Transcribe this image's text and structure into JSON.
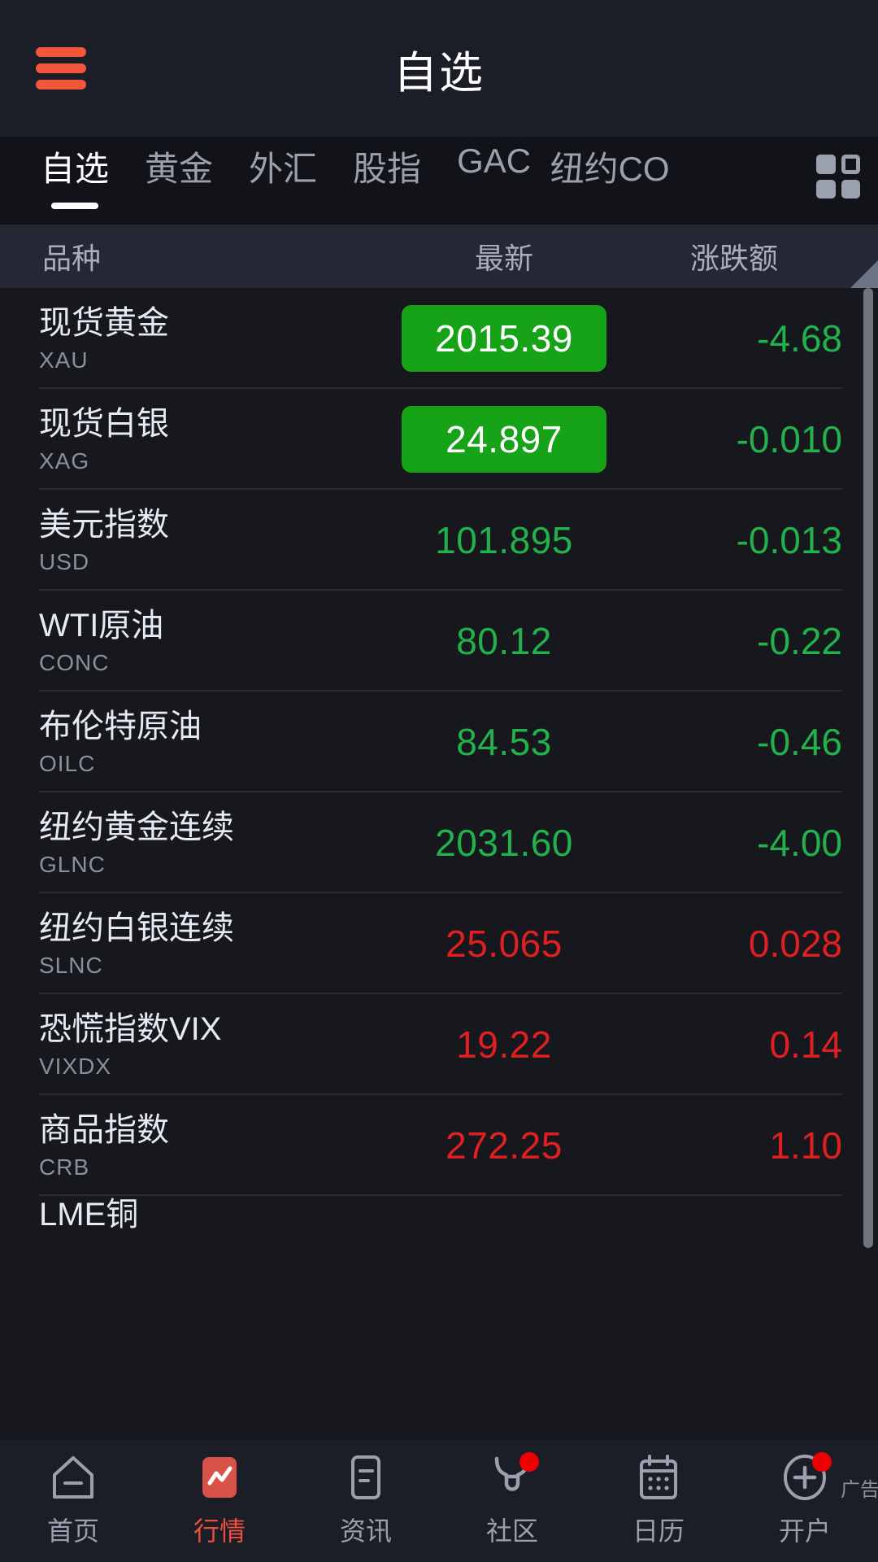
{
  "appbar": {
    "title": "自选",
    "menu_icon": "hamburger-icon"
  },
  "tabs": {
    "items": [
      {
        "label": "自选",
        "active": true
      },
      {
        "label": "黄金",
        "active": false
      },
      {
        "label": "外汇",
        "active": false
      },
      {
        "label": "股指",
        "active": false
      },
      {
        "label": "GAC",
        "active": false
      },
      {
        "label": "纽约CO",
        "active": false
      }
    ],
    "grid_icon": "grid-icon"
  },
  "columns": {
    "name": "品种",
    "last": "最新",
    "change": "涨跌额"
  },
  "quotes": [
    {
      "name": "现货黄金",
      "code": "XAU",
      "price": "2015.39",
      "change": "-4.68",
      "dir": "down",
      "highlight": true,
      "partial": false
    },
    {
      "name": "现货白银",
      "code": "XAG",
      "price": "24.897",
      "change": "-0.010",
      "dir": "down",
      "highlight": true,
      "partial": false
    },
    {
      "name": "美元指数",
      "code": "USD",
      "price": "101.895",
      "change": "-0.013",
      "dir": "down",
      "highlight": false,
      "partial": false
    },
    {
      "name": "WTI原油",
      "code": "CONC",
      "price": "80.12",
      "change": "-0.22",
      "dir": "down",
      "highlight": false,
      "partial": false
    },
    {
      "name": "布伦特原油",
      "code": "OILC",
      "price": "84.53",
      "change": "-0.46",
      "dir": "down",
      "highlight": false,
      "partial": false
    },
    {
      "name": "纽约黄金连续",
      "code": "GLNC",
      "price": "2031.60",
      "change": "-4.00",
      "dir": "down",
      "highlight": false,
      "partial": false
    },
    {
      "name": "纽约白银连续",
      "code": "SLNC",
      "price": "25.065",
      "change": "0.028",
      "dir": "up",
      "highlight": false,
      "partial": false
    },
    {
      "name": "恐慌指数VIX",
      "code": "VIXDX",
      "price": "19.22",
      "change": "0.14",
      "dir": "up",
      "highlight": false,
      "partial": false
    },
    {
      "name": "商品指数",
      "code": "CRB",
      "price": "272.25",
      "change": "1.10",
      "dir": "up",
      "highlight": false,
      "partial": false
    },
    {
      "name": "LME铜",
      "code": "",
      "price": "",
      "change": "",
      "dir": "up",
      "highlight": false,
      "partial": true
    }
  ],
  "bottomnav": {
    "items": [
      {
        "label": "首页",
        "icon": "home-icon",
        "active": false,
        "badge": false
      },
      {
        "label": "行情",
        "icon": "chart-icon",
        "active": true,
        "badge": false
      },
      {
        "label": "资讯",
        "icon": "news-icon",
        "active": false,
        "badge": false
      },
      {
        "label": "社区",
        "icon": "bull-icon",
        "active": false,
        "badge": true
      },
      {
        "label": "日历",
        "icon": "calendar-icon",
        "active": false,
        "badge": false
      },
      {
        "label": "开户",
        "icon": "plus-circle-icon",
        "active": false,
        "badge": true
      }
    ],
    "ad_label": "广告"
  },
  "colors": {
    "up": "#e02020",
    "down": "#22b14c",
    "highlight_box": "#17a317",
    "accent": "#ec4f3d",
    "background": "#16181d"
  }
}
